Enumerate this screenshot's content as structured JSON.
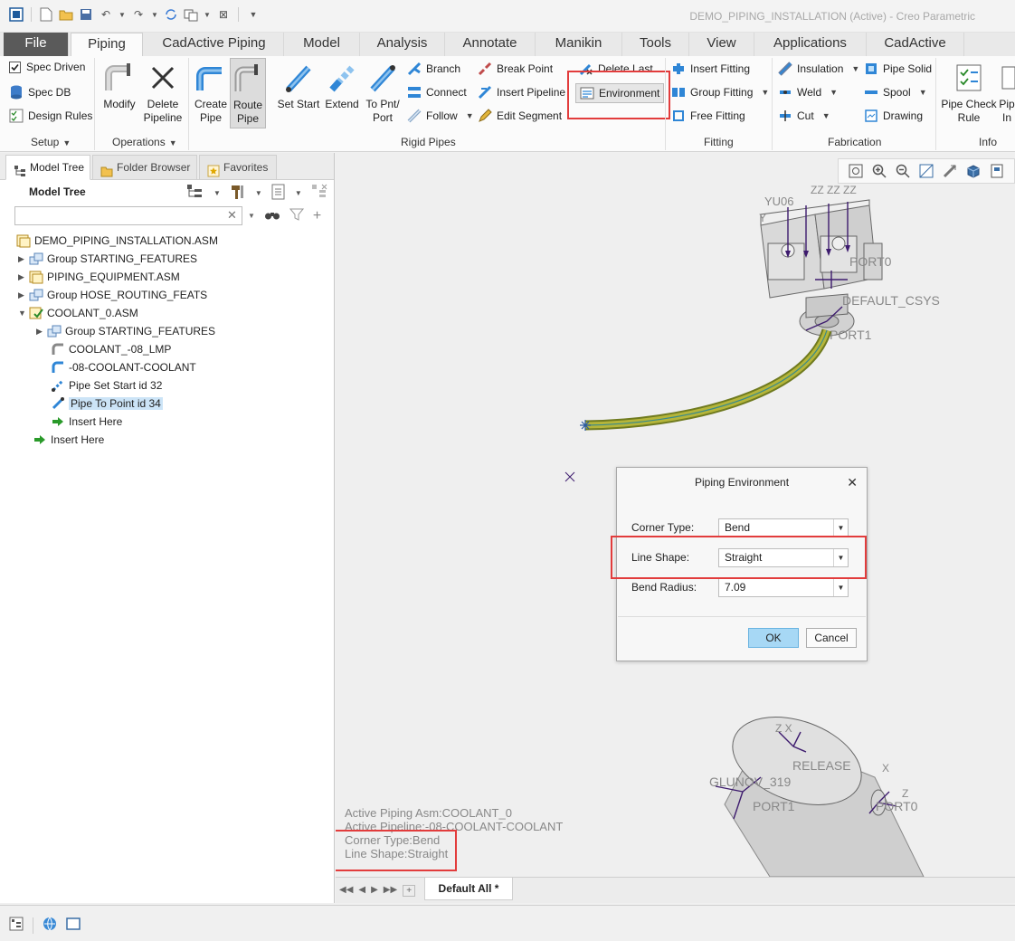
{
  "window": {
    "title": "DEMO_PIPING_INSTALLATION (Active) - Creo Parametric"
  },
  "ribbon_tabs": [
    "File",
    "Piping",
    "CadActive Piping",
    "Model",
    "Analysis",
    "Annotate",
    "Manikin",
    "Tools",
    "View",
    "Applications",
    "CadActive"
  ],
  "active_tab": "Piping",
  "ribbon": {
    "setup": {
      "spec_driven": "Spec Driven",
      "spec_driven_checked": true,
      "spec_db": "Spec DB",
      "design_rules": "Design Rules",
      "label": "Setup"
    },
    "operations": {
      "modify": "Modify",
      "delete_pipeline_l1": "Delete",
      "delete_pipeline_l2": "Pipeline",
      "label": "Operations"
    },
    "rigid_pipes": {
      "create_pipe_l1": "Create",
      "create_pipe_l2": "Pipe",
      "route_pipe_l1": "Route",
      "route_pipe_l2": "Pipe",
      "set_start": "Set Start",
      "extend": "Extend",
      "to_pnt_port_l1": "To Pnt/",
      "to_pnt_port_l2": "Port",
      "branch": "Branch",
      "connect": "Connect",
      "follow": "Follow",
      "break_point": "Break Point",
      "insert_pipeline": "Insert Pipeline",
      "edit_segment": "Edit Segment",
      "delete_last": "Delete Last",
      "environment": "Environment",
      "label": "Rigid Pipes"
    },
    "fitting": {
      "insert_fitting": "Insert Fitting",
      "group_fitting": "Group Fitting",
      "free_fitting": "Free Fitting",
      "label": "Fitting"
    },
    "fabrication": {
      "insulation": "Insulation",
      "weld": "Weld",
      "cut": "Cut",
      "pipe_solid": "Pipe Solid",
      "spool": "Spool",
      "drawing": "Drawing",
      "label": "Fabrication"
    },
    "info": {
      "pipe_check_rule_l1": "Pipe Check",
      "pipe_check_rule_l2": "Rule",
      "pipe_info_l1": "Pip",
      "pipe_info_l2": "In",
      "label": "Info"
    }
  },
  "left_panel": {
    "tabs": [
      "Model Tree",
      "Folder Browser",
      "Favorites"
    ],
    "header": "Model Tree",
    "search_value": "",
    "tree": [
      {
        "label": "DEMO_PIPING_INSTALLATION.ASM",
        "expander": "",
        "icon": "assembly-icon"
      },
      {
        "label": "Group STARTING_FEATURES",
        "expander": "▶",
        "icon": "group-icon"
      },
      {
        "label": "PIPING_EQUIPMENT.ASM",
        "expander": "▶",
        "icon": "assembly-icon"
      },
      {
        "label": "Group HOSE_ROUTING_FEATS",
        "expander": "▶",
        "icon": "group-icon"
      },
      {
        "label": "COOLANT_0.ASM",
        "expander": "▼",
        "icon": "active-assembly-icon"
      },
      {
        "label": "Group STARTING_FEATURES",
        "expander": "▶",
        "icon": "group-icon"
      },
      {
        "label": "COOLANT_-08_LMP",
        "expander": "",
        "icon": "pipe-part-icon"
      },
      {
        "label": "-08-COOLANT-COOLANT",
        "expander": "",
        "icon": "pipeline-icon"
      },
      {
        "label": "Pipe Set Start id 32",
        "expander": "",
        "icon": "pipe-start-icon"
      },
      {
        "label": "Pipe To Point id 34",
        "expander": "",
        "icon": "pipe-point-icon",
        "selected": true
      },
      {
        "label": "Insert Here",
        "expander": "",
        "icon": "insert-arrow-icon"
      },
      {
        "label": "Insert Here",
        "expander": "",
        "icon": "insert-arrow-icon"
      }
    ]
  },
  "graphics": {
    "labels": {
      "top_csys": "YU06",
      "port0_top": "PORT0",
      "default_csys": "DEFAULT_CSYS",
      "port1_top": "PORT1",
      "release": "RELEASE",
      "glu": "GLUNOV_319",
      "port1_bottom": "PORT1",
      "port0_bottom": "PORT0"
    },
    "status_lines": [
      "Active Piping Asm:COOLANT_0",
      "Active Pipeline:-08-COOLANT-COOLANT",
      "Corner Type:Bend",
      "Line Shape:Straight"
    ],
    "bottom_tab": "Default All *"
  },
  "dialog": {
    "title": "Piping Environment",
    "corner_type_label": "Corner Type:",
    "corner_type_value": "Bend",
    "line_shape_label": "Line Shape:",
    "line_shape_value": "Straight",
    "bend_radius_label": "Bend Radius:",
    "bend_radius_value": "7.09",
    "ok": "OK",
    "cancel": "Cancel"
  },
  "colors": {
    "highlight": "#e23c3c",
    "pipe": "#b5b53a",
    "ok_button": "#a7d8f5",
    "selection": "#cce4f7"
  }
}
